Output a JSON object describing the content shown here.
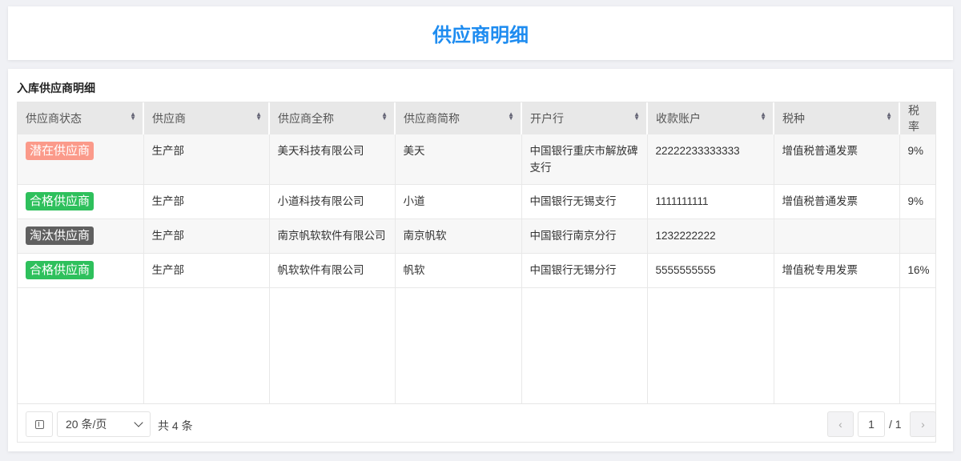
{
  "header": {
    "title": "供应商明细"
  },
  "section": {
    "title": "入库供应商明细"
  },
  "table": {
    "columns": [
      "供应商状态",
      "供应商",
      "供应商全称",
      "供应商简称",
      "开户行",
      "收款账户",
      "税种",
      "税率"
    ],
    "rows": [
      {
        "status": "潜在供应商",
        "status_color": "#fb9a8a",
        "dept": "生产部",
        "full_name": "美天科技有限公司",
        "short_name": "美天",
        "bank": "中国银行重庆市解放碑支行",
        "account": "22222233333333",
        "tax_type": "增值税普通发票",
        "tax_rate": "9%"
      },
      {
        "status": "合格供应商",
        "status_color": "#2ec05c",
        "dept": "生产部",
        "full_name": "小道科技有限公司",
        "short_name": "小道",
        "bank": "中国银行无锡支行",
        "account": "1111111111",
        "tax_type": "增值税普通发票",
        "tax_rate": "9%"
      },
      {
        "status": "淘汰供应商",
        "status_color": "#606060",
        "dept": "生产部",
        "full_name": "南京帆软软件有限公司",
        "short_name": "南京帆软",
        "bank": "中国银行南京分行",
        "account": "1232222222",
        "tax_type": "",
        "tax_rate": ""
      },
      {
        "status": "合格供应商",
        "status_color": "#2ec05c",
        "dept": "生产部",
        "full_name": "帆软软件有限公司",
        "short_name": "帆软",
        "bank": "中国银行无锡分行",
        "account": "5555555555",
        "tax_type": "增值税专用发票",
        "tax_rate": "16%"
      }
    ]
  },
  "pagination": {
    "page_size": "20 条/页",
    "total": "共 4 条",
    "current_page": "1",
    "total_pages": "/ 1"
  }
}
